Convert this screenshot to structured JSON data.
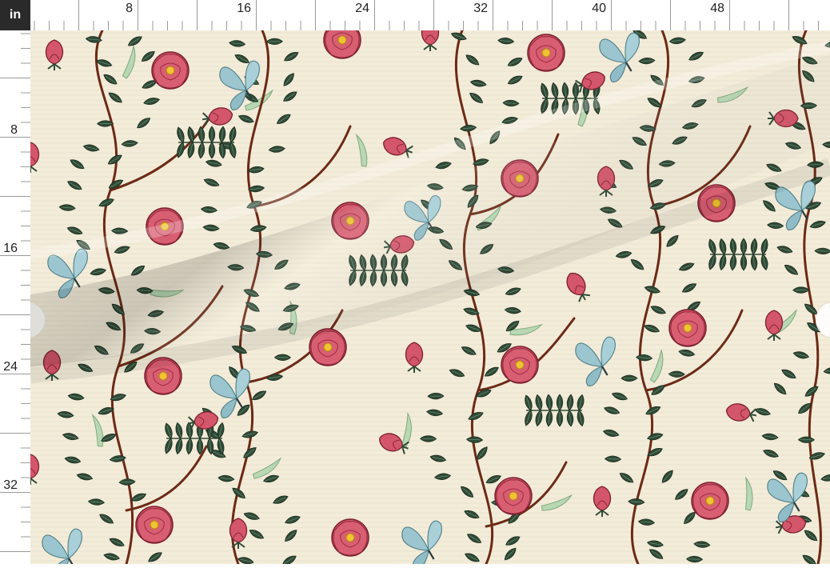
{
  "ruler": {
    "unit": "in",
    "top_labels": [
      "8",
      "16",
      "24",
      "32",
      "40",
      "48"
    ],
    "left_labels": [
      "8",
      "16",
      "24",
      "32"
    ]
  },
  "fabric": {
    "pattern": "rose-vine-butterfly",
    "colors": {
      "background": "#f3ecd9",
      "rose": "#d4566a",
      "rose_dark": "#b23a4f",
      "rose_center": "#f1c232",
      "leaf": "#2f4a36",
      "pale_leaf": "#b8d8b4",
      "stem": "#6b2a16",
      "butterfly": "#9cc6cf"
    }
  }
}
